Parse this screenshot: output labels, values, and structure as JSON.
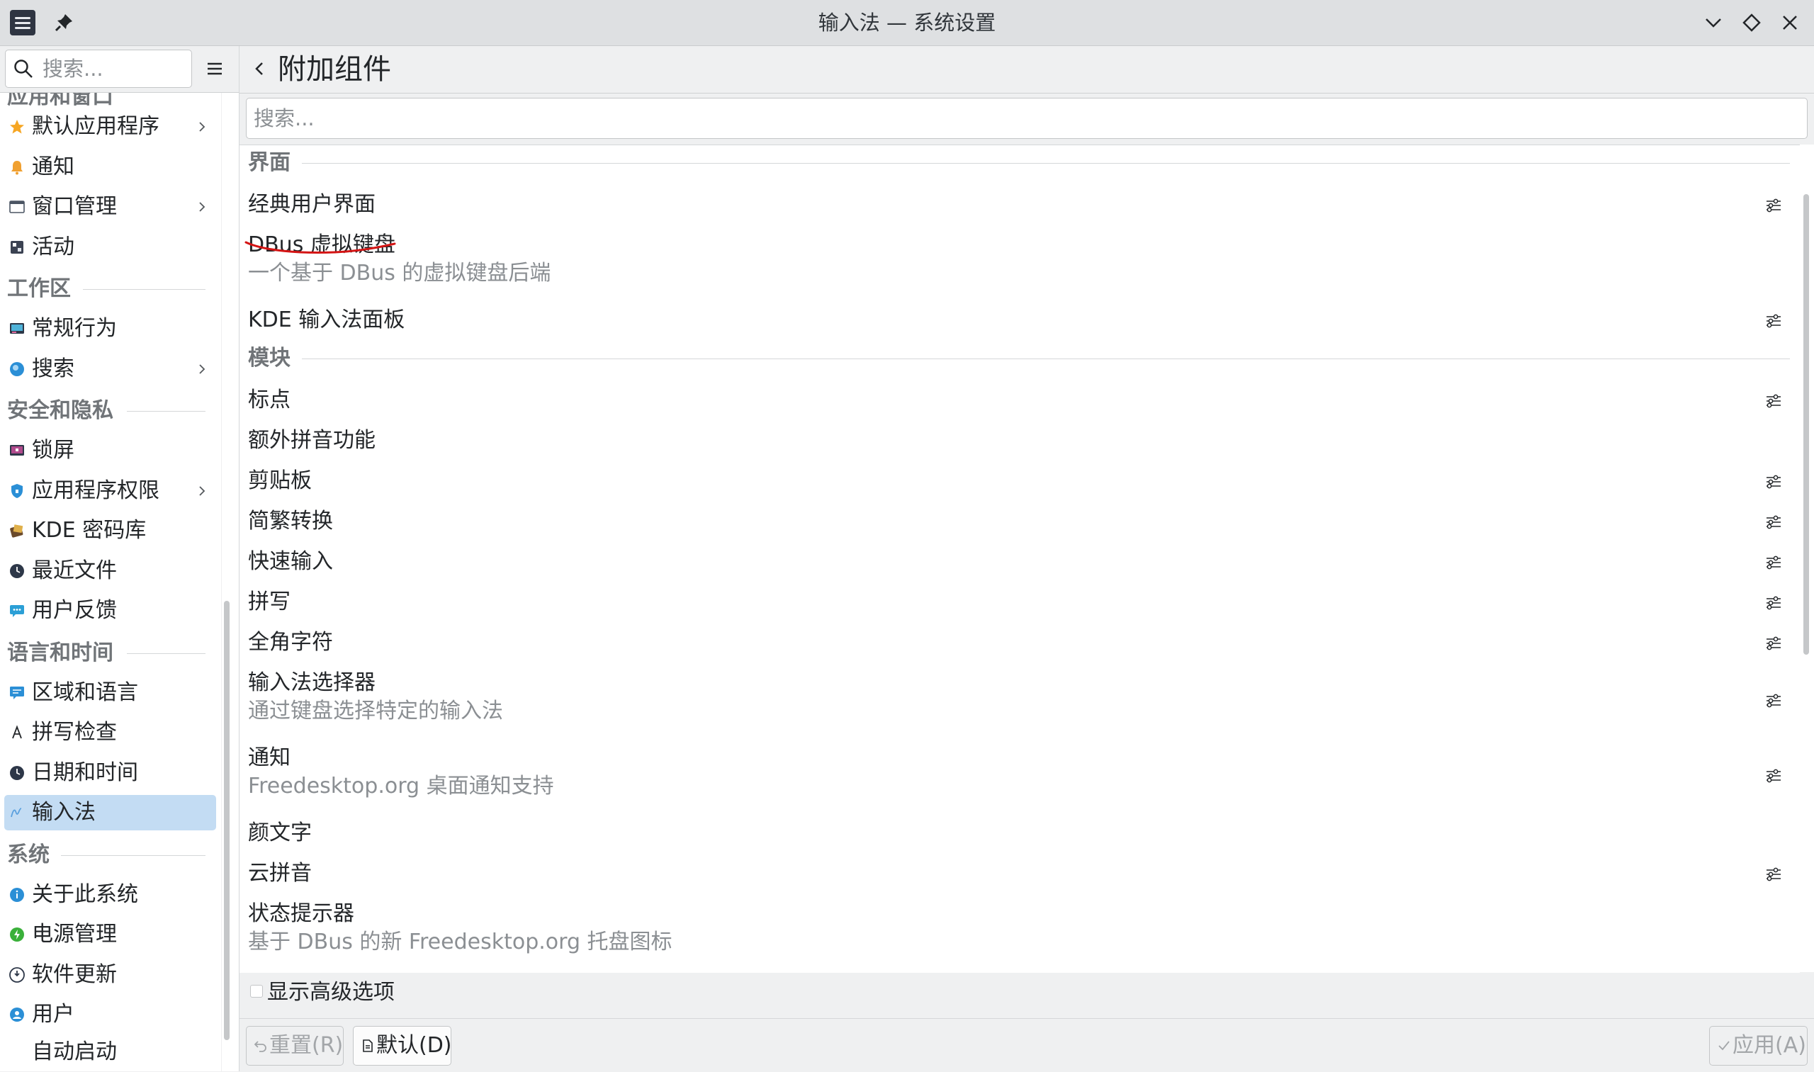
{
  "window": {
    "title": "输入法 — 系统设置"
  },
  "sidebar": {
    "search_placeholder": "搜索...",
    "top_partial": "应用和窗口",
    "groups": [
      {
        "items": [
          {
            "label": "默认应用程序",
            "icon": "star-icon",
            "submenu": true
          },
          {
            "label": "通知",
            "icon": "bell-icon",
            "submenu": false
          },
          {
            "label": "窗口管理",
            "icon": "window-icon",
            "submenu": true
          },
          {
            "label": "活动",
            "icon": "activities-icon",
            "submenu": false
          }
        ]
      },
      {
        "title": "工作区",
        "items": [
          {
            "label": "常规行为",
            "icon": "general-behavior-icon",
            "submenu": false
          },
          {
            "label": "搜索",
            "icon": "search-globe-icon",
            "submenu": true
          }
        ]
      },
      {
        "title": "安全和隐私",
        "items": [
          {
            "label": "锁屏",
            "icon": "lock-screen-icon",
            "submenu": false
          },
          {
            "label": "应用程序权限",
            "icon": "shield-icon",
            "submenu": true
          },
          {
            "label": "KDE 密码库",
            "icon": "wallet-icon",
            "submenu": false
          },
          {
            "label": "最近文件",
            "icon": "recent-files-icon",
            "submenu": false
          },
          {
            "label": "用户反馈",
            "icon": "feedback-icon",
            "submenu": false
          }
        ]
      },
      {
        "title": "语言和时间",
        "items": [
          {
            "label": "区域和语言",
            "icon": "region-language-icon",
            "submenu": false
          },
          {
            "label": "拼写检查",
            "icon": "spellcheck-icon",
            "submenu": false
          },
          {
            "label": "日期和时间",
            "icon": "clock-icon",
            "submenu": false
          },
          {
            "label": "输入法",
            "icon": "input-method-icon",
            "submenu": false,
            "active": true
          }
        ]
      },
      {
        "title": "系统",
        "items": [
          {
            "label": "关于此系统",
            "icon": "info-icon",
            "submenu": false
          },
          {
            "label": "电源管理",
            "icon": "power-icon",
            "submenu": false
          },
          {
            "label": "软件更新",
            "icon": "update-icon",
            "submenu": false
          },
          {
            "label": "用户",
            "icon": "users-icon",
            "submenu": false
          }
        ]
      }
    ],
    "bottom_partial": "自动启动"
  },
  "page": {
    "title": "附加组件",
    "search_placeholder": "搜索...",
    "sections": [
      {
        "title": "界面",
        "items": [
          {
            "name": "经典用户界面",
            "desc": "",
            "configurable": true
          },
          {
            "name": "DBus 虚拟键盘",
            "desc": "一个基于 DBus 的虚拟键盘后端",
            "configurable": false
          },
          {
            "name": "KDE 输入法面板",
            "desc": "",
            "configurable": true
          }
        ]
      },
      {
        "title": "模块",
        "items": [
          {
            "name": "标点",
            "desc": "",
            "configurable": true
          },
          {
            "name": "额外拼音功能",
            "desc": "",
            "configurable": false
          },
          {
            "name": "剪贴板",
            "desc": "",
            "configurable": true
          },
          {
            "name": "简繁转换",
            "desc": "",
            "configurable": true
          },
          {
            "name": "快速输入",
            "desc": "",
            "configurable": true
          },
          {
            "name": "拼写",
            "desc": "",
            "configurable": true
          },
          {
            "name": "全角字符",
            "desc": "",
            "configurable": true
          },
          {
            "name": "输入法选择器",
            "desc": "通过键盘选择特定的输入法",
            "configurable": true
          },
          {
            "name": "通知",
            "desc": "Freedesktop.org 桌面通知支持",
            "configurable": true
          },
          {
            "name": "颜文字",
            "desc": "",
            "configurable": false
          },
          {
            "name": "云拼音",
            "desc": "",
            "configurable": true
          },
          {
            "name": "状态提示器",
            "desc": "基于 DBus 的新 Freedesktop.org 托盘图标",
            "configurable": false
          }
        ]
      }
    ],
    "show_advanced_label": "显示高级选项",
    "show_advanced_checked": false
  },
  "footer": {
    "reset_label": "重置(R)",
    "defaults_label": "默认(D)",
    "apply_label": "应用(A)"
  },
  "colors": {
    "accent_selection": "#c3dcf3",
    "annotation_stroke": "#d41414"
  }
}
